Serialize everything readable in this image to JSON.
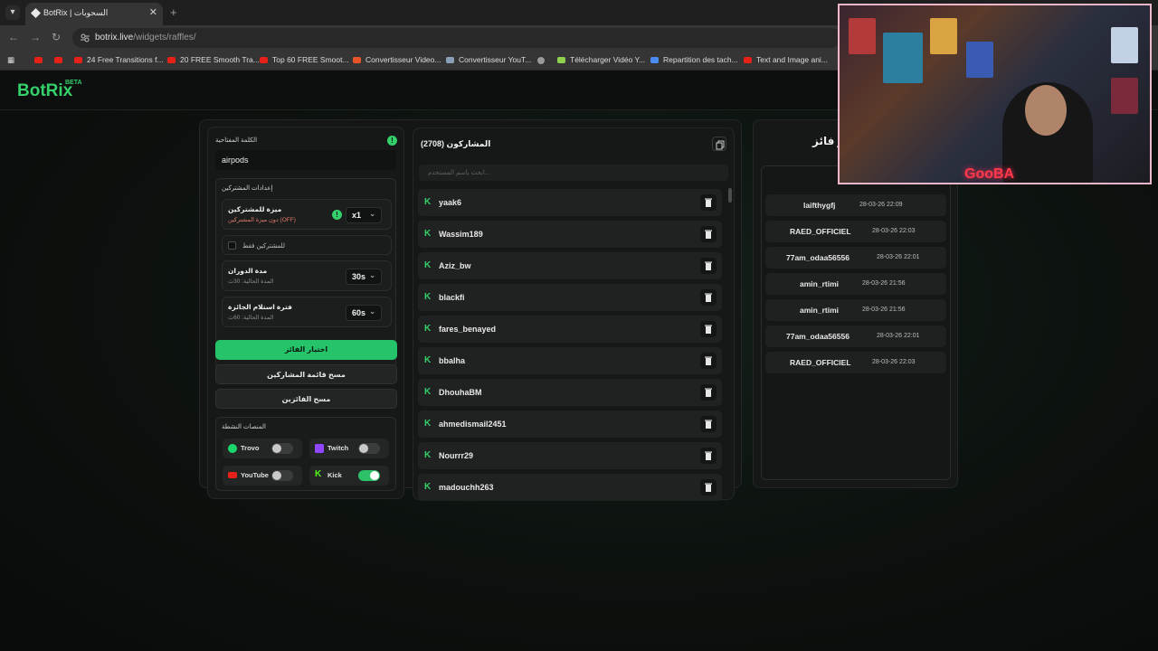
{
  "browser": {
    "tab_title": "BotRix | السحوبات",
    "url_host": "botrix.live",
    "url_path": "/widgets/raffles/",
    "bookmarks": [
      "24 Free Transitions f...",
      "20 FREE Smooth Tra...",
      "Top 60 FREE Smoot...",
      "Convertisseur Video...",
      "Convertisseur YouT...",
      "Télécharger Vidéo Y...",
      "Repartition des tach...",
      "Text and Image ani..."
    ]
  },
  "app": {
    "logo": "BotRix",
    "beta": "BETA"
  },
  "settings": {
    "keyword_label": "الكلمة المفتاحية",
    "keyword_value": "airpods",
    "participants_settings_label": "إعدادات المشتركين",
    "subscriber_bonus_title": "ميزة للمشتركين",
    "subscriber_bonus_sub": "دون ميزة المشتركين (OFF)",
    "multiplier": "x1",
    "subs_only_label": "للمشتركين فقط",
    "spin_duration_title": "مدة الدوران",
    "spin_duration_sub": "المدة الحالية: 30ث",
    "spin_duration_value": "30s",
    "claim_period_title": "فترة استلام الجائزة",
    "claim_period_sub": "المدة الحالية: 60ث",
    "claim_period_value": "60s",
    "pick_winner": "اختيار الفائز",
    "clear_participants": "مسح قائمة المشاركين",
    "clear_winners": "مسح الفائزين",
    "platforms_label": "المنصات النشطة",
    "platforms": [
      {
        "name": "Trovo",
        "on": false,
        "color": "#19d66b"
      },
      {
        "name": "Twitch",
        "on": false,
        "color": "#9146ff"
      },
      {
        "name": "YouTube",
        "on": false,
        "color": "#e62117"
      },
      {
        "name": "Kick",
        "on": true,
        "color": "#53fc18"
      }
    ]
  },
  "participants": {
    "header": "المشاركون (2708)",
    "search_placeholder": "ابحث باسم المستخدم...",
    "list": [
      "yaak6",
      "Wassim189",
      "Aziz_bw",
      "blackfi",
      "fares_benayed",
      "bbalha",
      "DhouhaBM",
      "ahmedismail2451",
      "Nourrr29",
      "madouchh263"
    ]
  },
  "winners": {
    "header": "آخر فائز",
    "list": [
      {
        "name": "laifthygfj",
        "date": "28-03-26 22:09"
      },
      {
        "name": "RAED_OFFICIEL",
        "date": "28-03-26 22:03"
      },
      {
        "name": "77am_odaa56556",
        "date": "28-03-26 22:01"
      },
      {
        "name": "amin_rtimi",
        "date": "28-03-26 21:56"
      },
      {
        "name": "amin_rtimi",
        "date": "28-03-26 21:56"
      },
      {
        "name": "77am_odaa56556",
        "date": "28-03-26 22:01"
      },
      {
        "name": "RAED_OFFICIEL",
        "date": "28-03-26 22:03"
      }
    ]
  },
  "webcam": {
    "tag": "GooBA"
  }
}
